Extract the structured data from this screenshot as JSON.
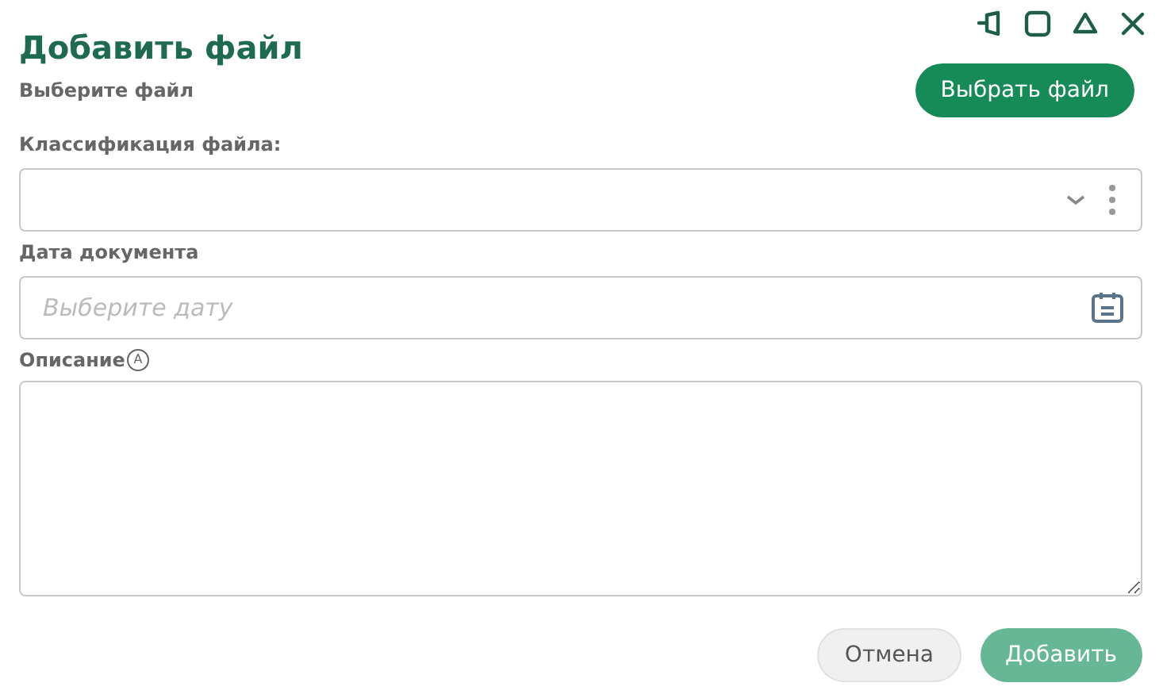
{
  "dialog": {
    "title": "Добавить файл"
  },
  "file": {
    "label": "Выберите файл",
    "button": "Выбрать файл"
  },
  "classification": {
    "label": "Классификация файла:"
  },
  "date": {
    "label": "Дата документа",
    "placeholder": "Выберите дату"
  },
  "description": {
    "label": "Описание",
    "badge": "A"
  },
  "buttons": [
    {
      "label": "Отмена",
      "kind": "secondary",
      "disabled": false
    },
    {
      "label": "Добавить",
      "kind": "primary",
      "disabled": true
    }
  ]
}
